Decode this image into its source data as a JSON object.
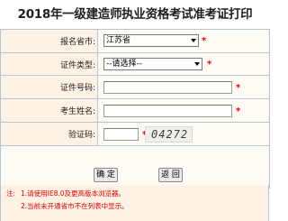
{
  "page": {
    "title": "2018年一级建造师执业资格考试准考证打印"
  },
  "form": {
    "province": {
      "label": "报名省市:",
      "value": "江苏省",
      "required_mark": "*"
    },
    "cert_type": {
      "label": "证件类型:",
      "value": "--请选择--",
      "required_mark": "*"
    },
    "cert_number": {
      "label": "证件号码:",
      "value": "",
      "required_mark": "*"
    },
    "name": {
      "label": "考生姓名:",
      "value": "",
      "required_mark": "*"
    },
    "captcha": {
      "label": "验证码:",
      "value": "",
      "required_mark": "*",
      "image_text": "04272"
    }
  },
  "buttons": {
    "confirm": "确 定",
    "back": "返 回"
  },
  "notes": {
    "prefix": "注:",
    "line1": "1.请使用IE8.0及更高版本浏览器。",
    "line2": "2.当前未开通省市不在列表中显示。"
  },
  "colors": {
    "required": "#e00000",
    "label_bg": "#fdf2e3",
    "border": "#b8c4d6"
  }
}
